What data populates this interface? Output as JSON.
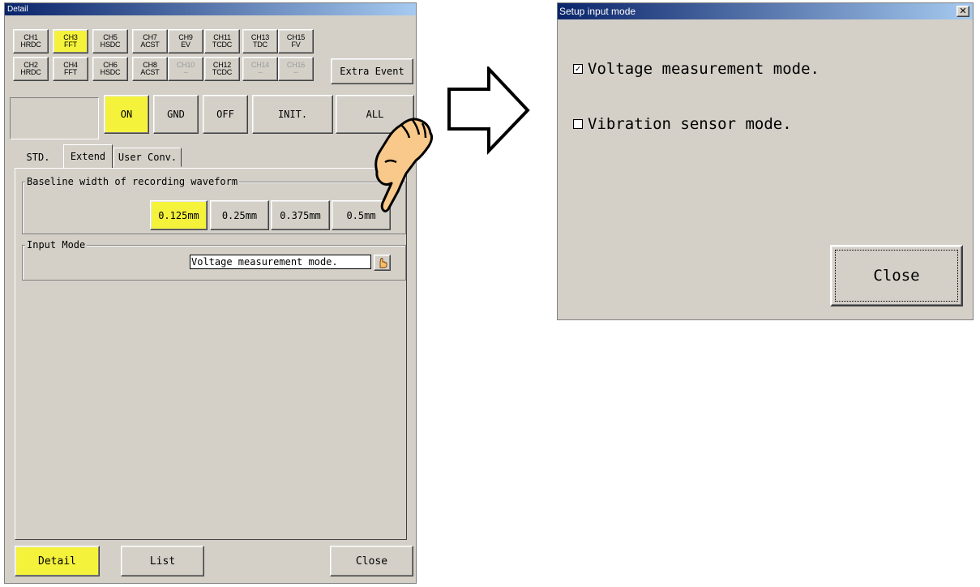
{
  "detail_window": {
    "title": "Detail",
    "channels_row1": [
      {
        "ch": "CH1",
        "mode": "HRDC",
        "state": "normal"
      },
      {
        "ch": "CH3",
        "mode": "FFT",
        "state": "selected"
      },
      {
        "ch": "CH5",
        "mode": "HSDC",
        "state": "normal"
      },
      {
        "ch": "CH7",
        "mode": "ACST",
        "state": "normal"
      },
      {
        "ch": "CH9",
        "mode": "EV",
        "state": "normal"
      },
      {
        "ch": "CH11",
        "mode": "TCDC",
        "state": "normal"
      },
      {
        "ch": "CH13",
        "mode": "TDC",
        "state": "normal"
      },
      {
        "ch": "CH15",
        "mode": "FV",
        "state": "normal"
      }
    ],
    "channels_row2": [
      {
        "ch": "CH2",
        "mode": "HRDC",
        "state": "normal"
      },
      {
        "ch": "CH4",
        "mode": "FFT",
        "state": "normal"
      },
      {
        "ch": "CH6",
        "mode": "HSDC",
        "state": "normal"
      },
      {
        "ch": "CH8",
        "mode": "ACST",
        "state": "normal"
      },
      {
        "ch": "CH10",
        "mode": "--",
        "state": "disabled"
      },
      {
        "ch": "CH12",
        "mode": "TCDC",
        "state": "normal"
      },
      {
        "ch": "CH14",
        "mode": "--",
        "state": "disabled"
      },
      {
        "ch": "CH16",
        "mode": "--",
        "state": "disabled"
      }
    ],
    "extra_event_label": "Extra Event",
    "on_label": "ON",
    "gnd_label": "GND",
    "off_label": "OFF",
    "init_label": "INIT.",
    "all_label": "ALL",
    "tabs": [
      "STD.",
      "Extend",
      "User Conv."
    ],
    "active_tab": "Extend",
    "baseline_group": {
      "label": "Baseline width of recording waveform",
      "options": [
        "0.125mm",
        "0.25mm",
        "0.375mm",
        "0.5mm"
      ],
      "selected": "0.125mm"
    },
    "input_mode_group": {
      "label": "Input Mode",
      "value": "Voltage measurement mode."
    },
    "footer": {
      "detail_label": "Detail",
      "list_label": "List",
      "close_label": "Close"
    }
  },
  "setup_dialog": {
    "title": "Setup input mode",
    "close_x": "✕",
    "options": [
      {
        "label": "Voltage measurement mode.",
        "checked": true
      },
      {
        "label": "Vibration sensor mode.",
        "checked": false
      }
    ],
    "close_label": "Close"
  },
  "colors": {
    "window_bg": "#d4d0c8",
    "selected_yellow": "#f5f23c",
    "titlebar_start": "#0a246a",
    "titlebar_end": "#a6caf0"
  }
}
